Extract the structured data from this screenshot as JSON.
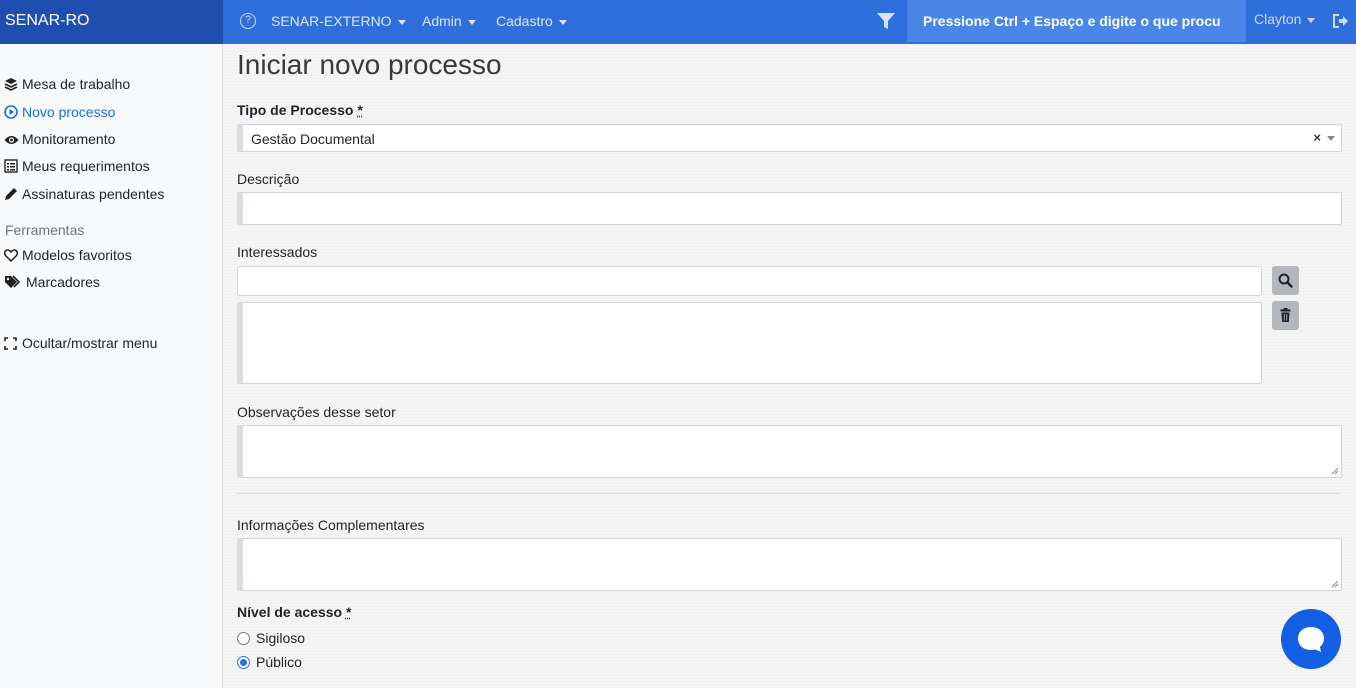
{
  "topbar": {
    "brand": "SENAR-RO",
    "nav": [
      {
        "label": "SENAR-EXTERNO"
      },
      {
        "label": "Admin"
      },
      {
        "label": "Cadastro"
      }
    ],
    "search_placeholder": "Pressione Ctrl + Espaço e digite o que procu",
    "user": "Clayton"
  },
  "sidebar": {
    "items": [
      {
        "label": "Mesa de trabalho",
        "icon": "layers-icon"
      },
      {
        "label": "Novo processo",
        "icon": "play-circle-icon",
        "active": true
      },
      {
        "label": "Monitoramento",
        "icon": "eye-icon"
      },
      {
        "label": "Meus requerimentos",
        "icon": "list-alt-icon"
      },
      {
        "label": "Assinaturas pendentes",
        "icon": "pen-icon"
      }
    ],
    "tools_title": "Ferramentas",
    "tools": [
      {
        "label": "Modelos favoritos",
        "icon": "heart-icon"
      },
      {
        "label": "Marcadores",
        "icon": "tags-icon"
      }
    ],
    "toggle_menu": "Ocultar/mostrar menu"
  },
  "form": {
    "title": "Iniciar novo processo",
    "tipo_label": "Tipo de Processo",
    "required_mark": "*",
    "tipo_value": "Gestão Documental",
    "clear_symbol": "×",
    "descricao_label": "Descrição",
    "descricao_value": "",
    "interessados_label": "Interessados",
    "interessados_value": "",
    "observacoes_label": "Observações desse setor",
    "info_label": "Informações Complementares",
    "nivel_label": "Nível de acesso",
    "nivel_options": [
      {
        "label": "Sigiloso",
        "checked": false
      },
      {
        "label": "Público",
        "checked": true
      }
    ]
  },
  "colors": {
    "topbar": "#2f6fdc",
    "brand_bg": "#1e4fb0",
    "accent": "#1a6fe0",
    "chat": "#1360e5"
  }
}
